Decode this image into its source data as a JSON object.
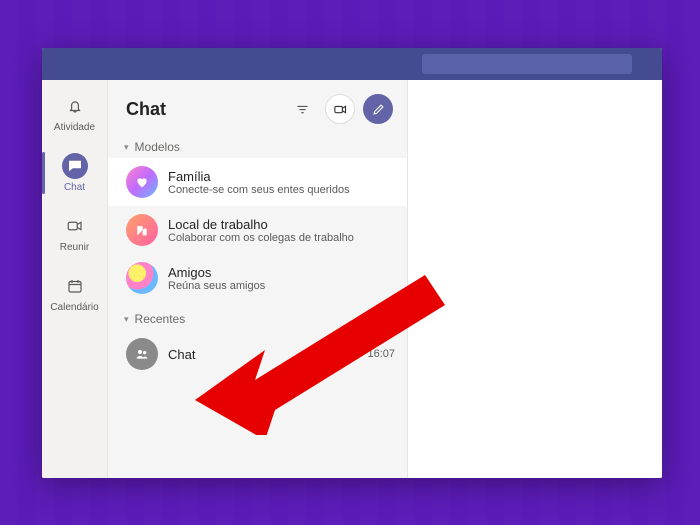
{
  "rail": {
    "activity": "Atividade",
    "chat": "Chat",
    "meet": "Reunir",
    "calendar": "Calendário"
  },
  "chat": {
    "title": "Chat",
    "sections": {
      "models": "Modelos",
      "recent": "Recentes"
    },
    "models": [
      {
        "title": "Família",
        "sub": "Conecte-se com seus entes queridos"
      },
      {
        "title": "Local de trabalho",
        "sub": "Colaborar com os colegas de trabalho"
      },
      {
        "title": "Amigos",
        "sub": "Reúna seus amigos"
      }
    ],
    "recent": [
      {
        "title": "Chat",
        "time": "16:07"
      }
    ]
  }
}
